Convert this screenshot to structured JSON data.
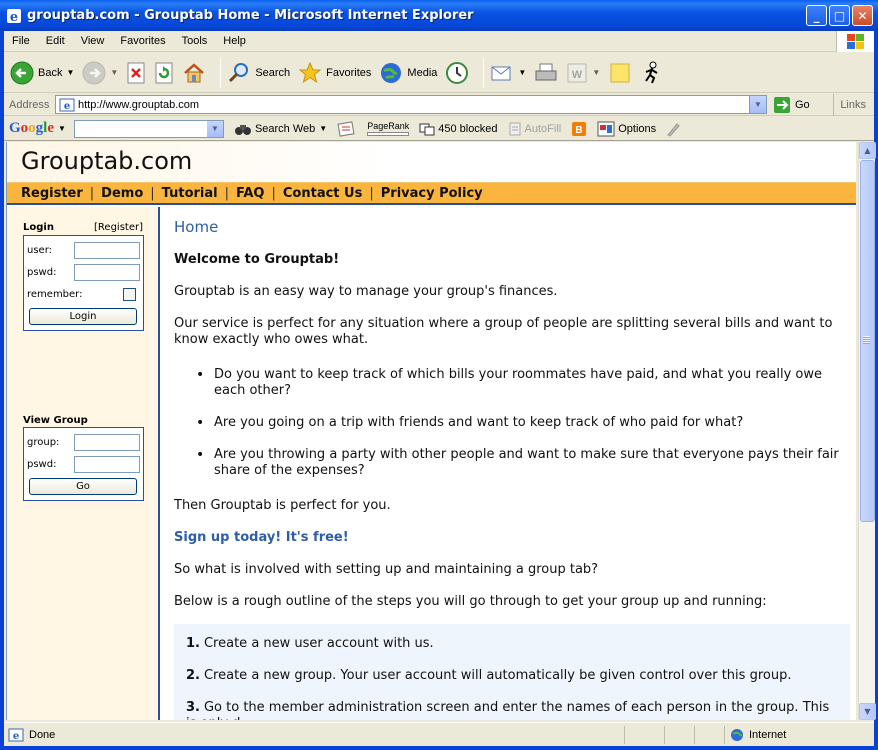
{
  "window": {
    "title": "grouptab.com - Grouptab Home - Microsoft Internet Explorer"
  },
  "menu": [
    "File",
    "Edit",
    "View",
    "Favorites",
    "Tools",
    "Help"
  ],
  "toolbar": {
    "back": "Back",
    "search": "Search",
    "favorites": "Favorites",
    "media": "Media"
  },
  "address": {
    "label": "Address",
    "url": "http://www.grouptab.com",
    "go": "Go",
    "links": "Links"
  },
  "googlebar": {
    "logo": [
      "G",
      "o",
      "o",
      "g",
      "l",
      "e"
    ],
    "search_web": "Search Web",
    "pagerank": "PageRank",
    "blocked": "450 blocked",
    "autofill": "AutoFill",
    "options": "Options"
  },
  "site": {
    "title": "Grouptab.com",
    "nav": [
      "Register",
      "Demo",
      "Tutorial",
      "FAQ",
      "Contact Us",
      "Privacy Policy"
    ]
  },
  "sidebar": {
    "login_title": "Login",
    "register_link": "[Register]",
    "user_label": "user:",
    "pswd_label": "pswd:",
    "remember_label": "remember:",
    "login_button": "Login",
    "viewgroup_title": "View Group",
    "group_label": "group:",
    "vg_pswd_label": "pswd:",
    "go_button": "Go"
  },
  "main": {
    "heading": "Home",
    "welcome": "Welcome to Grouptab!",
    "intro": "Grouptab is an easy way to manage your group's finances.",
    "service": "Our service is perfect for any situation where a group of people are splitting several bills and want to know exactly who owes what.",
    "bullets": [
      "Do you want to keep track of which bills your roommates have paid, and what you really owe each other?",
      "Are you going on a trip with friends and want to keep track of who paid for what?",
      "Are you throwing a party with other people and want to make sure that everyone pays their fair share of the expenses?"
    ],
    "then": "Then Grouptab is perfect for you.",
    "signup": "Sign up today! It's free!",
    "involved": "So what is involved with setting up and maintaining a group tab?",
    "outline": "Below is a rough outline of the steps you will go through to get your group up and running:",
    "steps": [
      {
        "num": "1.",
        "text": "Create a new user account with us."
      },
      {
        "num": "2.",
        "text": "Create a new group. Your user account will automatically be given control over this group."
      },
      {
        "num": "3.",
        "text": "Go to the member administration screen and enter the names of each person in the group. This is only d"
      }
    ]
  },
  "status": {
    "text": "Done",
    "zone": "Internet"
  }
}
